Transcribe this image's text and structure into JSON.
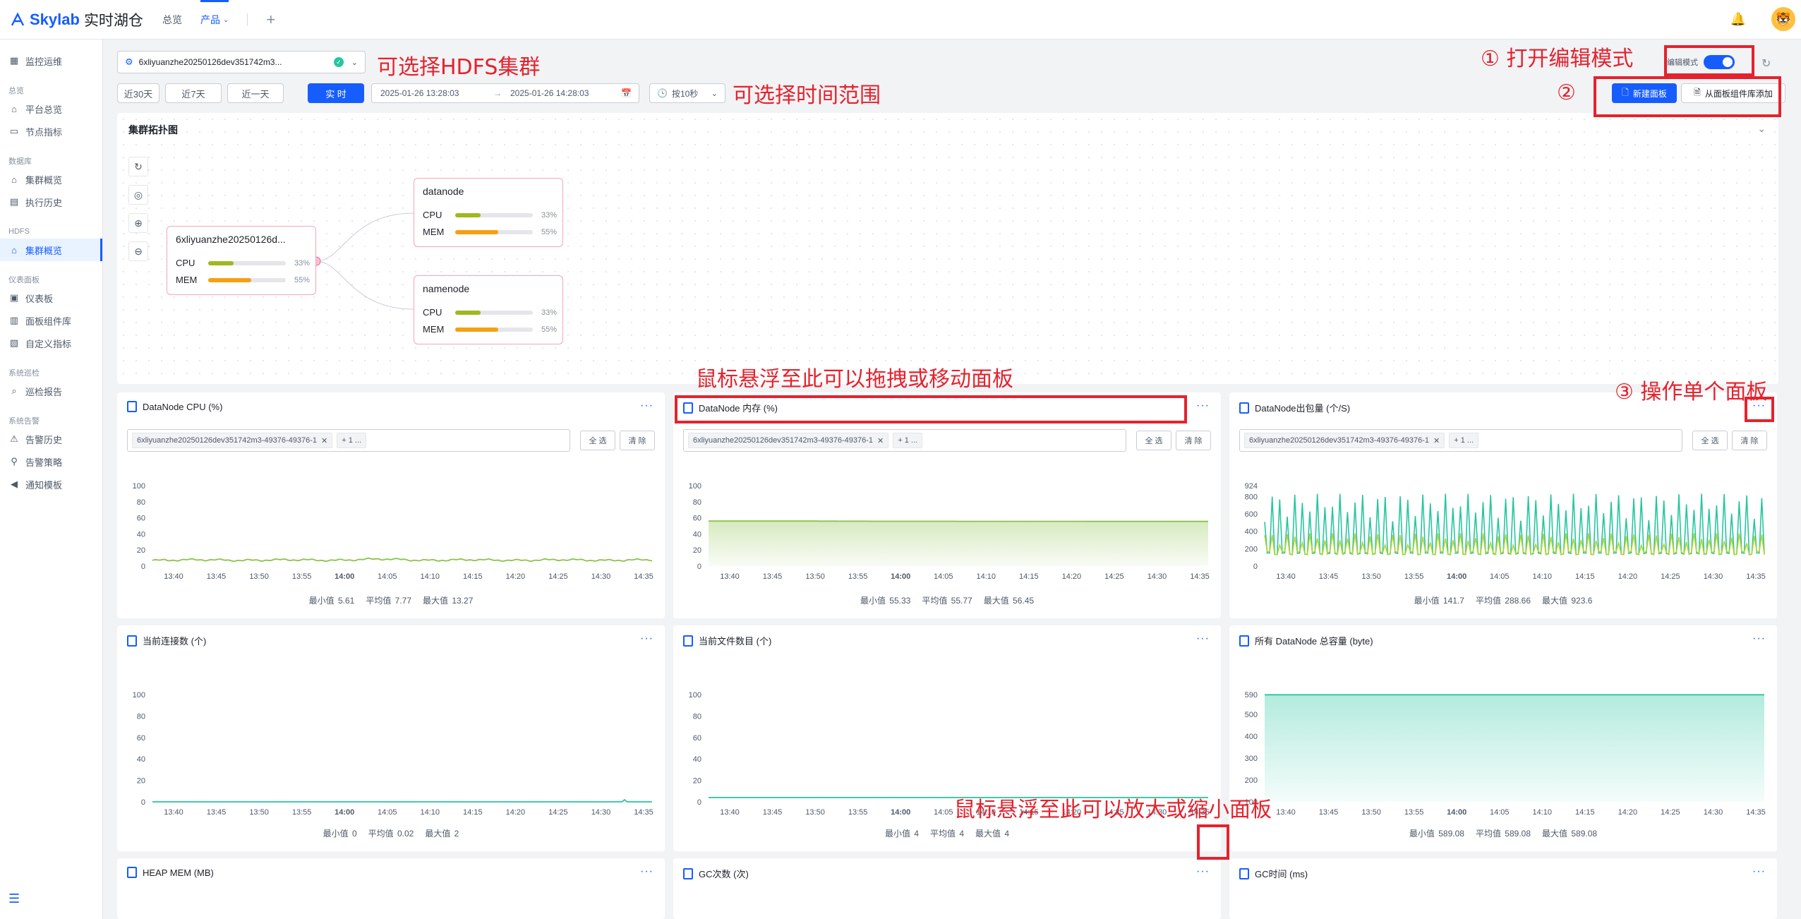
{
  "app": {
    "brand": "Skylab",
    "product": "实时湖仓"
  },
  "topnav": {
    "items": [
      "总览",
      "产品"
    ],
    "active_index": 1,
    "add": "+"
  },
  "sidebar": {
    "sections": [
      {
        "group": "",
        "items": [
          {
            "label": "监控运维",
            "icon": "dashboard-icon"
          }
        ]
      },
      {
        "group": "总览",
        "items": [
          {
            "label": "平台总览",
            "icon": "home-icon"
          },
          {
            "label": "节点指标",
            "icon": "metrics-icon"
          }
        ]
      },
      {
        "group": "数据库",
        "items": [
          {
            "label": "集群概览",
            "icon": "home-icon"
          },
          {
            "label": "执行历史",
            "icon": "history-icon"
          }
        ]
      },
      {
        "group": "HDFS",
        "items": [
          {
            "label": "集群概览",
            "icon": "home-icon",
            "active": true
          }
        ]
      },
      {
        "group": "仪表面板",
        "items": [
          {
            "label": "仪表板",
            "icon": "board-icon"
          },
          {
            "label": "面板组件库",
            "icon": "library-icon"
          },
          {
            "label": "自定义指标",
            "icon": "custom-icon"
          }
        ]
      },
      {
        "group": "系统巡检",
        "items": [
          {
            "label": "巡检报告",
            "icon": "search-icon"
          }
        ]
      },
      {
        "group": "系统告警",
        "items": [
          {
            "label": "告警历史",
            "icon": "alarm-icon"
          },
          {
            "label": "告警策略",
            "icon": "policy-icon"
          },
          {
            "label": "通知模板",
            "icon": "speaker-icon"
          }
        ]
      }
    ]
  },
  "toolbar": {
    "cluster": "6xliyuanzhe20250126dev351742m3...",
    "ranges": [
      "近30天",
      "近7天",
      "近一天",
      "实 时"
    ],
    "active_range": 3,
    "start": "2025-01-26 13:28:03",
    "arrow": "→",
    "end": "2025-01-26 14:28:03",
    "refresh": "按10秒",
    "edit_mode_label": "编辑模式",
    "edit_mode_on": true,
    "new_panel": "新建面板",
    "add_from_library": "从面板组件库添加"
  },
  "annotations": {
    "cluster": "可选择HDFS集群",
    "time": "可选择时间范围",
    "edit": "① 打开编辑模式",
    "step2": "②",
    "drag": "鼠标悬浮至此可以拖拽或移动面板",
    "single": "③ 操作单个面板",
    "resize": "鼠标悬浮至此可以放大或缩小面板"
  },
  "topology": {
    "title": "集群拓扑图",
    "root": {
      "name": "6xliyuanzhe20250126d...",
      "cpu": 33,
      "mem": 55
    },
    "children": [
      {
        "name": "datanode",
        "cpu": 33,
        "mem": 55
      },
      {
        "name": "namenode",
        "cpu": 33,
        "mem": 55
      }
    ],
    "cpu_label": "CPU",
    "mem_label": "MEM",
    "cpu_pct": "33%",
    "mem_pct": "55%",
    "colors": {
      "cpu": "#a0b820",
      "mem": "#f5a011"
    }
  },
  "filter": {
    "tag": "6xliyuanzhe20250126dev351742m3-49376-49376-1",
    "more": "+ 1 ...",
    "select_all": "全 选",
    "clear": "清 除"
  },
  "panels": [
    {
      "title": "DataNode CPU (%)",
      "has_filter": true,
      "stats": {
        "min": "最小值 5.61",
        "avg": "平均值 7.77",
        "max": "最大值 13.27"
      }
    },
    {
      "title": "DataNode 内存 (%)",
      "has_filter": true,
      "stats": {
        "min": "最小值 55.33",
        "avg": "平均值 55.77",
        "max": "最大值 56.45"
      }
    },
    {
      "title": "DataNode出包量 (个/S)",
      "has_filter": true,
      "stats": {
        "min": "最小值 141.7",
        "avg": "平均值 288.66",
        "max": "最大值 923.6"
      }
    },
    {
      "title": "当前连接数 (个)",
      "has_filter": false,
      "stats": {
        "min": "最小值 0",
        "avg": "平均值 0.02",
        "max": "最大值 2"
      }
    },
    {
      "title": "当前文件数目 (个)",
      "has_filter": false,
      "stats": {
        "min": "最小值 4",
        "avg": "平均值 4",
        "max": "最大值 4"
      }
    },
    {
      "title": "所有 DataNode 总容量 (byte)",
      "has_filter": false,
      "stats": {
        "min": "最小值 589.08",
        "avg": "平均值 589.08",
        "max": "最大值 589.08"
      }
    },
    {
      "title": "HEAP MEM (MB)",
      "has_filter": false
    },
    {
      "title": "GC次数 (次)",
      "has_filter": false
    },
    {
      "title": "GC时间 (ms)",
      "has_filter": false
    }
  ],
  "chart_data": [
    {
      "type": "line",
      "title": "DataNode CPU (%)",
      "x": [
        "13:40",
        "13:45",
        "13:50",
        "13:55",
        "14:00",
        "14:05",
        "14:10",
        "14:15",
        "14:20",
        "14:25",
        "14:30",
        "14:35"
      ],
      "yticks": [
        0,
        20,
        40,
        60,
        80,
        100
      ],
      "ylim": [
        0,
        100
      ],
      "series": [
        {
          "values": [
            7,
            8,
            7,
            8,
            7,
            9,
            7,
            8,
            7,
            8,
            7,
            8
          ],
          "min": 5.61,
          "max": 13.27
        }
      ],
      "color": "#8bc34a"
    },
    {
      "type": "area",
      "title": "DataNode 内存 (%)",
      "x": [
        "13:40",
        "13:45",
        "13:50",
        "13:55",
        "14:00",
        "14:05",
        "14:10",
        "14:15",
        "14:20",
        "14:25",
        "14:30",
        "14:35"
      ],
      "yticks": [
        0,
        20,
        40,
        60,
        80,
        100
      ],
      "ylim": [
        0,
        100
      ],
      "series": [
        {
          "values": [
            56,
            56,
            56,
            55.8,
            55.7,
            55.7,
            55.6,
            55.6,
            55.6,
            55.5,
            55.5,
            55.5
          ]
        }
      ],
      "color": "#8bc34a"
    },
    {
      "type": "line",
      "title": "DataNode出包量 (个/S)",
      "x": [
        "13:40",
        "13:45",
        "13:50",
        "13:55",
        "14:00",
        "14:05",
        "14:10",
        "14:15",
        "14:20",
        "14:25",
        "14:30",
        "14:35"
      ],
      "yticks": [
        0,
        200,
        400,
        600,
        800,
        924
      ],
      "ylim": [
        0,
        924
      ],
      "series": [
        {
          "min": 141.7,
          "max": 923.6,
          "period_minutes": 1.2
        },
        {
          "min": 150,
          "max": 420,
          "period_minutes": 1.2
        }
      ],
      "colors": [
        "#26c6a0",
        "#b5d334"
      ]
    },
    {
      "type": "line",
      "title": "当前连接数 (个)",
      "x": [
        "13:40",
        "13:45",
        "13:50",
        "13:55",
        "14:00",
        "14:05",
        "14:10",
        "14:15",
        "14:20",
        "14:25",
        "14:30",
        "14:35"
      ],
      "yticks": [
        0,
        20,
        40,
        60,
        80,
        100
      ],
      "ylim": [
        0,
        100
      ],
      "series": [
        {
          "values": [
            0,
            0,
            0,
            0,
            0,
            0,
            0,
            0,
            0,
            0,
            0,
            0
          ],
          "spike_at": "14:34",
          "spike": 2
        }
      ],
      "color": "#26c6a0"
    },
    {
      "type": "line",
      "title": "当前文件数目 (个)",
      "x": [
        "13:40",
        "13:45",
        "13:50",
        "13:55",
        "14:00",
        "14:05",
        "14:10",
        "14:15",
        "14:20",
        "14:25",
        "14:30",
        "14:35"
      ],
      "yticks": [
        0,
        20,
        40,
        60,
        80,
        100
      ],
      "ylim": [
        0,
        100
      ],
      "series": [
        {
          "values": [
            4,
            4,
            4,
            4,
            4,
            4,
            4,
            4,
            4,
            4,
            4,
            4
          ]
        }
      ],
      "color": "#26c6a0"
    },
    {
      "type": "area",
      "title": "所有 DataNode 总容量 (byte)",
      "x": [
        "13:40",
        "13:45",
        "13:50",
        "13:55",
        "14:00",
        "14:05",
        "14:10",
        "14:15",
        "14:20",
        "14:25",
        "14:30",
        "14:35"
      ],
      "yticks": [
        100,
        200,
        300,
        400,
        500,
        590
      ],
      "ylim": [
        100,
        590
      ],
      "series": [
        {
          "values": [
            589.08,
            589.08,
            589.08,
            589.08,
            589.08,
            589.08,
            589.08,
            589.08,
            589.08,
            589.08,
            589.08,
            589.08
          ]
        }
      ],
      "color": "#26c6a0"
    }
  ]
}
